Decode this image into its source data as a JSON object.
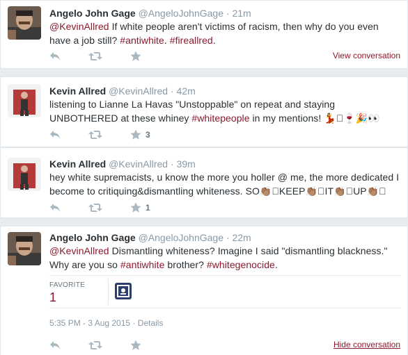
{
  "colors": {
    "link": "#8b1a2d",
    "secondary": "#8899a6",
    "action_icon": "#aab8c2",
    "background": "#e8ecef"
  },
  "tweets": [
    {
      "fullname": "Angelo John Gage",
      "username": "@AngeloJohnGage",
      "dot": "·",
      "time": "21m",
      "text_parts": [
        {
          "t": "@KevinAllred",
          "link": true
        },
        {
          "t": " If white people aren't victims of racism, then why do you even have a job still? ",
          "link": false
        },
        {
          "t": "#antiwhite",
          "link": true
        },
        {
          "t": ". ",
          "link": false
        },
        {
          "t": "#fireallred",
          "link": true
        },
        {
          "t": ".",
          "link": false
        }
      ],
      "favorite_count": "",
      "conversation_link": "View conversation"
    },
    {
      "fullname": "Kevin Allred",
      "username": "@KevinAllred",
      "dot": "·",
      "time": "42m",
      "text_parts": [
        {
          "t": "listening to Lianne La Havas \"Unstoppable\" on repeat and staying UNBOTHERED at these whiney ",
          "link": false
        },
        {
          "t": "#whitepeople",
          "link": true
        },
        {
          "t": " in my mentions! 💃􏿿🍷🎉👀",
          "link": false
        }
      ],
      "favorite_count": "3",
      "conversation_link": ""
    },
    {
      "fullname": "Kevin Allred",
      "username": "@KevinAllred",
      "dot": "·",
      "time": "39m",
      "text_parts": [
        {
          "t": "hey white supremacists, u know the more you holler @ me, the more dedicated I become to critiquing&dismantling whiteness. SO👏🏽􏿿KEEP👏🏽􏿿IT👏🏽􏿿UP👏🏽􏿿",
          "link": false
        }
      ],
      "favorite_count": "1",
      "conversation_link": ""
    },
    {
      "fullname": "Angelo John Gage",
      "username": "@AngeloJohnGage",
      "dot": "·",
      "time": "22m",
      "text_parts": [
        {
          "t": "@KevinAllred",
          "link": true
        },
        {
          "t": " Dismantling whiteness? Imagine I said \"dismantling blackness.\" Why are you so ",
          "link": false
        },
        {
          "t": "#antiwhite",
          "link": true
        },
        {
          "t": " brother? ",
          "link": false
        },
        {
          "t": "#whitegenocide",
          "link": true
        },
        {
          "t": ".",
          "link": false
        }
      ],
      "favorite_label": "FAVORITE",
      "favorite_value": "1",
      "timestamp": "5:35 PM - 3 Aug 2015",
      "meta_dot": "·",
      "details": "Details",
      "favorite_count": "",
      "conversation_link": "Hide conversation"
    }
  ],
  "icons": {
    "reply": "reply-icon",
    "retweet": "retweet-icon",
    "favorite": "favorite-star-icon"
  }
}
